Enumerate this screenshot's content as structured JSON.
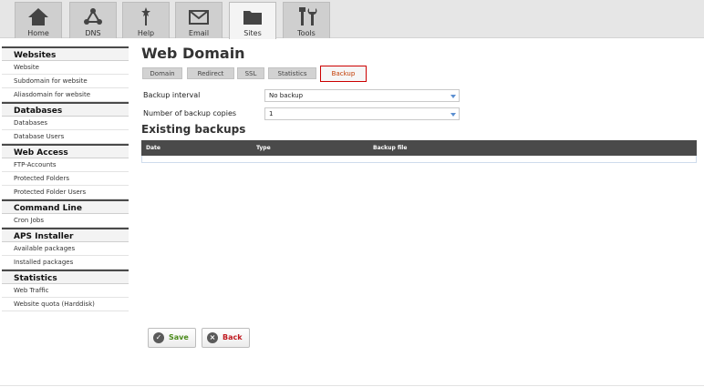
{
  "nav": {
    "tabs": [
      {
        "label": "Home",
        "icon": "home-icon"
      },
      {
        "label": "DNS",
        "icon": "dns-network-icon"
      },
      {
        "label": "Help",
        "icon": "help-wand-icon"
      },
      {
        "label": "Email",
        "icon": "envelope-icon"
      },
      {
        "label": "Sites",
        "icon": "folder-icon",
        "active": true
      },
      {
        "label": "Tools",
        "icon": "tools-icon"
      }
    ]
  },
  "sidebar": {
    "sections": [
      {
        "title": "Websites",
        "items": [
          "Website",
          "Subdomain for website",
          "Aliasdomain for website"
        ]
      },
      {
        "title": "Databases",
        "items": [
          "Databases",
          "Database Users"
        ]
      },
      {
        "title": "Web Access",
        "items": [
          "FTP-Accounts",
          "Protected Folders",
          "Protected Folder Users"
        ]
      },
      {
        "title": "Command Line",
        "items": [
          "Cron Jobs"
        ]
      },
      {
        "title": "APS Installer",
        "items": [
          "Available packages",
          "Installed packages"
        ]
      },
      {
        "title": "Statistics",
        "items": [
          "Web Traffic",
          "Website quota (Harddisk)"
        ]
      }
    ]
  },
  "main": {
    "title": "Web Domain",
    "tabs": [
      {
        "label": "Domain"
      },
      {
        "label": "Redirect"
      },
      {
        "label": "SSL"
      },
      {
        "label": "Statistics"
      },
      {
        "label": "Backup",
        "active": true
      }
    ],
    "backup_interval": {
      "label": "Backup interval",
      "value": "No backup"
    },
    "backup_copies": {
      "label": "Number of backup copies",
      "value": "1"
    },
    "existing_title": "Existing backups",
    "table_headers": {
      "date": "Date",
      "type": "Type",
      "file": "Backup file"
    }
  },
  "buttons": {
    "save": "Save",
    "back": "Back"
  },
  "colors": {
    "active_tab_border": "#cc0000",
    "save_text": "#4a8a1a",
    "back_text": "#c0191f",
    "table_header": "#4a4a4a"
  }
}
